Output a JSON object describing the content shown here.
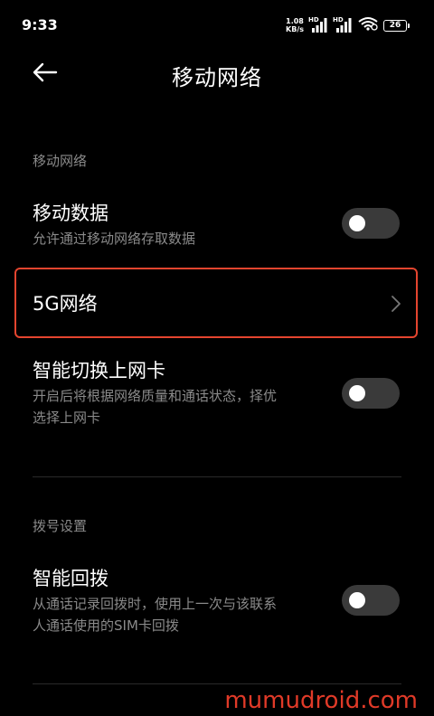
{
  "status_bar": {
    "time": "9:33",
    "speed_value": "1.08",
    "speed_unit": "KB/s",
    "hd1": "HD",
    "hd2": "HD",
    "battery": "26"
  },
  "header": {
    "title": "移动网络",
    "back_icon": "arrow-left-icon"
  },
  "sections": [
    {
      "label": "移动网络",
      "rows": [
        {
          "title": "移动数据",
          "subtitle": "允许通过移动网络存取数据",
          "toggle_on": false
        },
        {
          "title": "5G网络",
          "type": "nav"
        },
        {
          "title": "智能切换上网卡",
          "subtitle_line1": "开启后将根据网络质量和通话状态，择优",
          "subtitle_line2": "选择上网卡",
          "toggle_on": false
        }
      ]
    },
    {
      "label": "拨号设置",
      "rows": [
        {
          "title": "智能回拨",
          "subtitle_line1": "从通话记录回拨时，使用上一次与该联系",
          "subtitle_line2": "人通话使用的SIM卡回拨",
          "toggle_on": false
        }
      ]
    }
  ],
  "colors": {
    "background": "#000000",
    "highlight": "#e4452f",
    "secondary_text": "#8a8a8a",
    "toggle_off": "#3a3a3a"
  },
  "watermark": "mumudroid.com"
}
